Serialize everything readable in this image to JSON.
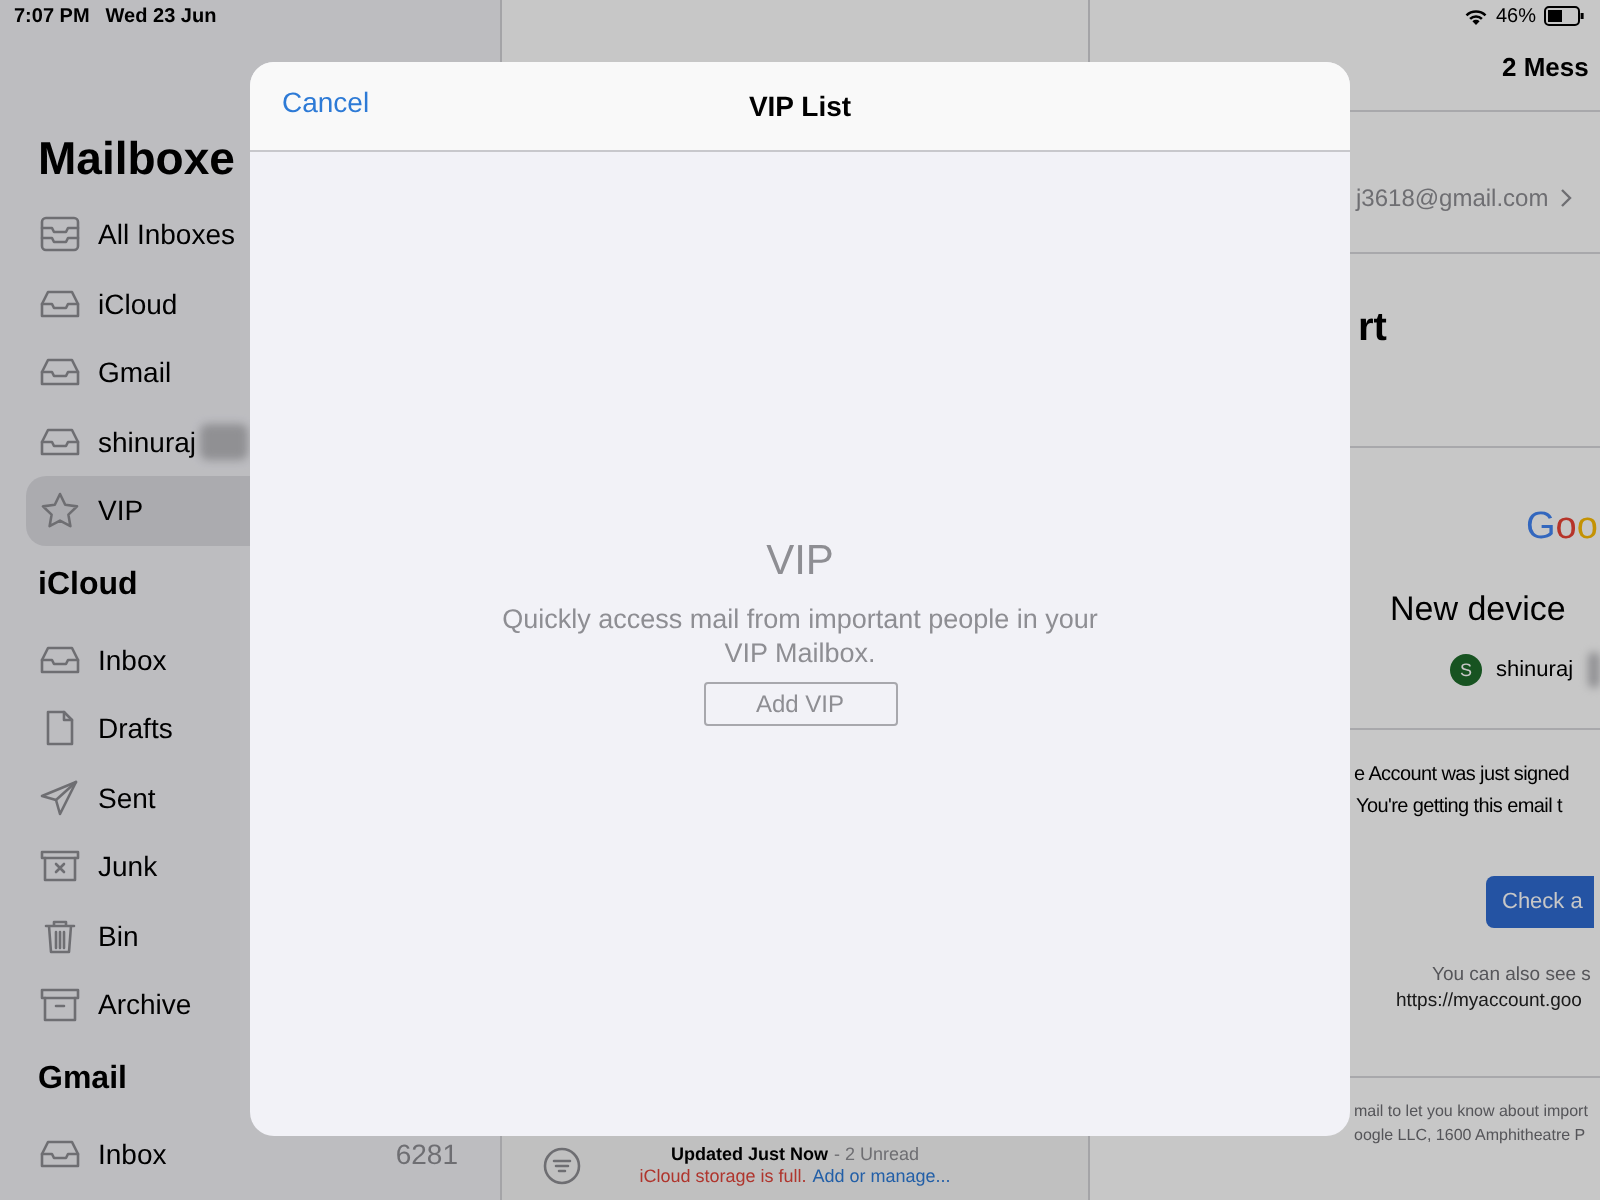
{
  "status_bar": {
    "time": "7:07 PM",
    "date": "Wed 23 Jun",
    "battery": "46%"
  },
  "sidebar": {
    "title": "Mailboxe",
    "sections": [
      {
        "items": [
          {
            "label": "All Inboxes",
            "kind": "all_inboxes",
            "selected": false
          },
          {
            "label": "iCloud",
            "kind": "inbox",
            "selected": false
          },
          {
            "label": "Gmail",
            "kind": "inbox",
            "selected": false
          },
          {
            "label": "shinuraj",
            "kind": "inbox",
            "selected": false,
            "blurred": true
          },
          {
            "label": "VIP",
            "kind": "vip",
            "selected": true
          }
        ]
      },
      {
        "heading": "iCloud",
        "items": [
          {
            "label": "Inbox",
            "kind": "inbox",
            "selected": false
          },
          {
            "label": "Drafts",
            "kind": "drafts",
            "selected": false
          },
          {
            "label": "Sent",
            "kind": "sent",
            "selected": false
          },
          {
            "label": "Junk",
            "kind": "junk",
            "selected": false
          },
          {
            "label": "Bin",
            "kind": "bin",
            "selected": false
          },
          {
            "label": "Archive",
            "kind": "archive",
            "selected": false
          }
        ]
      },
      {
        "heading": "Gmail",
        "items": [
          {
            "label": "Inbox",
            "kind": "inbox",
            "count": "6281",
            "selected": false
          }
        ]
      }
    ]
  },
  "message_list": {
    "footer": {
      "status": "Updated Just Now",
      "unread": "- 2 Unread",
      "warning": "iCloud storage is full.",
      "link": "Add or manage..."
    }
  },
  "email": {
    "header": "2 Mess",
    "sender": "j3618@gmail.com",
    "subject": "rt",
    "logo": "Goo",
    "heading": "New device",
    "account": {
      "initial": "S",
      "name": "shinuraj",
      "blurred": true
    },
    "body": [
      "e Account was just signed",
      "You're getting this email t"
    ],
    "button": "Check a",
    "note": [
      "You can also see s",
      "https://myaccount.goo"
    ],
    "footer": [
      "mail to let you know about import",
      "oogle LLC, 1600 Amphitheatre P"
    ]
  },
  "modal": {
    "cancel": "Cancel",
    "title": "VIP List",
    "empty_title": "VIP",
    "empty_message": "Quickly access mail from important people in your VIP Mailbox.",
    "add_button": "Add VIP"
  }
}
